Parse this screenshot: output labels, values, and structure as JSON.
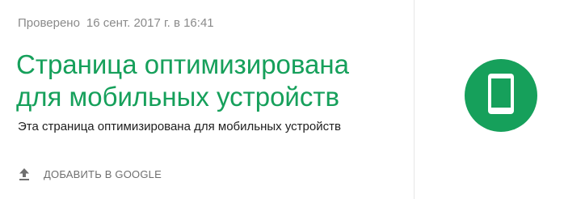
{
  "status": {
    "checked_label": "Проверено",
    "checked_date": "16 сент. 2017 г. в 16:41"
  },
  "result": {
    "title_line1": "Страница оптимизирована",
    "title_line2": "для мобильных устройств",
    "description": "Эта страница оптимизирована для мобильных устройств"
  },
  "actions": {
    "add_to_google_label": "ДОБАВИТЬ В GOOGLE",
    "add_icon": "upload-icon"
  },
  "badge": {
    "icon": "smartphone-icon",
    "color": "#16a05b"
  },
  "colors": {
    "accent": "#16a05b",
    "muted_text": "#8a8a8a",
    "body_text": "#202020"
  }
}
